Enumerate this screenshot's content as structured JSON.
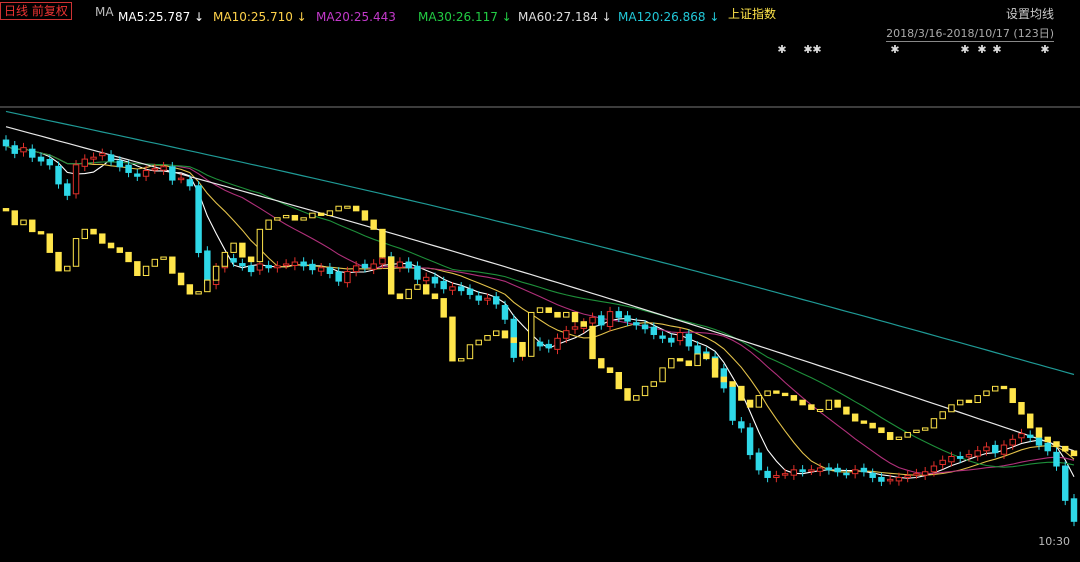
{
  "header": {
    "title": "日线 前复权",
    "ma_label": "MA",
    "ma_values": [
      {
        "label": "MA5:25.787",
        "arrow": "↓",
        "color": "#ffffff"
      },
      {
        "label": "MA10:25.710",
        "arrow": "↓",
        "color": "#ffd24a"
      },
      {
        "label": "MA20:25.443",
        "arrow": "",
        "color": "#c239c9"
      },
      {
        "label": "MA30:26.117",
        "arrow": "↓",
        "color": "#22cc44"
      },
      {
        "label": "MA60:27.184",
        "arrow": "↓",
        "color": "#dddddd"
      },
      {
        "label": "MA120:26.868",
        "arrow": "↓",
        "color": "#22c8d8"
      }
    ],
    "overlay_label": "上证指数",
    "settings_label": "设置均线",
    "date_range": "2018/3/16-2018/10/17 (123日)"
  },
  "footer": {
    "time_label": "10:30"
  },
  "chart_data": {
    "type": "candlestick",
    "date_range": [
      "2018-03-16",
      "2018-10-17"
    ],
    "count": 123,
    "grid": false,
    "legend": "top",
    "up_color": "#e0302a",
    "down_color": "#2fd8e8",
    "overlay_color": "#ffe54a",
    "overlay_series": "上证指数",
    "closes": [
      29.6,
      29.2,
      29.5,
      29.0,
      28.8,
      28.6,
      27.6,
      27.0,
      28.6,
      28.9,
      29.0,
      29.2,
      28.8,
      28.5,
      28.2,
      28.0,
      28.3,
      28.4,
      28.5,
      27.8,
      27.9,
      27.5,
      24.0,
      22.4,
      23.2,
      23.6,
      23.5,
      23.3,
      23.0,
      23.4,
      23.2,
      23.3,
      23.4,
      23.5,
      23.3,
      23.1,
      23.2,
      22.9,
      22.5,
      23.0,
      23.3,
      23.2,
      23.4,
      23.7,
      23.3,
      23.5,
      23.2,
      22.6,
      22.7,
      22.4,
      22.1,
      22.2,
      22.0,
      21.8,
      21.5,
      21.6,
      21.3,
      20.5,
      18.5,
      19.0,
      19.3,
      19.1,
      19.0,
      19.5,
      19.9,
      20.1,
      20.3,
      20.6,
      20.2,
      20.9,
      20.6,
      20.4,
      20.2,
      20.0,
      19.7,
      19.5,
      19.3,
      19.8,
      19.1,
      18.7,
      18.6,
      17.9,
      16.9,
      15.2,
      14.8,
      13.4,
      12.6,
      12.2,
      12.3,
      12.4,
      12.6,
      12.5,
      12.6,
      12.7,
      12.6,
      12.5,
      12.4,
      12.6,
      12.5,
      12.2,
      12.0,
      12.1,
      12.2,
      12.3,
      12.4,
      12.5,
      12.8,
      13.1,
      13.3,
      13.2,
      13.4,
      13.6,
      13.8,
      13.5,
      13.9,
      14.2,
      14.5,
      14.3,
      13.9,
      13.6,
      12.8,
      11.0,
      9.9
    ],
    "overlay_closes": [
      2880,
      2850,
      2860,
      2835,
      2830,
      2790,
      2750,
      2760,
      2820,
      2840,
      2830,
      2810,
      2800,
      2790,
      2770,
      2740,
      2760,
      2775,
      2780,
      2745,
      2720,
      2700,
      2705,
      2730,
      2760,
      2790,
      2810,
      2780,
      2770,
      2840,
      2860,
      2865,
      2870,
      2860,
      2865,
      2875,
      2870,
      2880,
      2890,
      2890,
      2880,
      2860,
      2840,
      2780,
      2700,
      2690,
      2710,
      2720,
      2700,
      2690,
      2650,
      2555,
      2560,
      2590,
      2600,
      2610,
      2620,
      2605,
      2595,
      2565,
      2660,
      2670,
      2660,
      2650,
      2660,
      2640,
      2630,
      2560,
      2540,
      2530,
      2495,
      2470,
      2480,
      2500,
      2510,
      2540,
      2560,
      2555,
      2545,
      2570,
      2560,
      2520,
      2510,
      2500,
      2470,
      2455,
      2480,
      2490,
      2485,
      2480,
      2470,
      2460,
      2450,
      2450,
      2470,
      2455,
      2440,
      2425,
      2420,
      2410,
      2400,
      2385,
      2390,
      2400,
      2405,
      2410,
      2430,
      2445,
      2460,
      2470,
      2465,
      2480,
      2490,
      2500,
      2495,
      2465,
      2440,
      2410,
      2390,
      2380,
      2370,
      2360,
      2350
    ],
    "ylim": [
      8.5,
      32
    ],
    "overlay_ylim": [
      2150,
      3120
    ],
    "ma_series": [
      "MA5",
      "MA10",
      "MA20",
      "MA30",
      "MA60",
      "MA120"
    ]
  }
}
